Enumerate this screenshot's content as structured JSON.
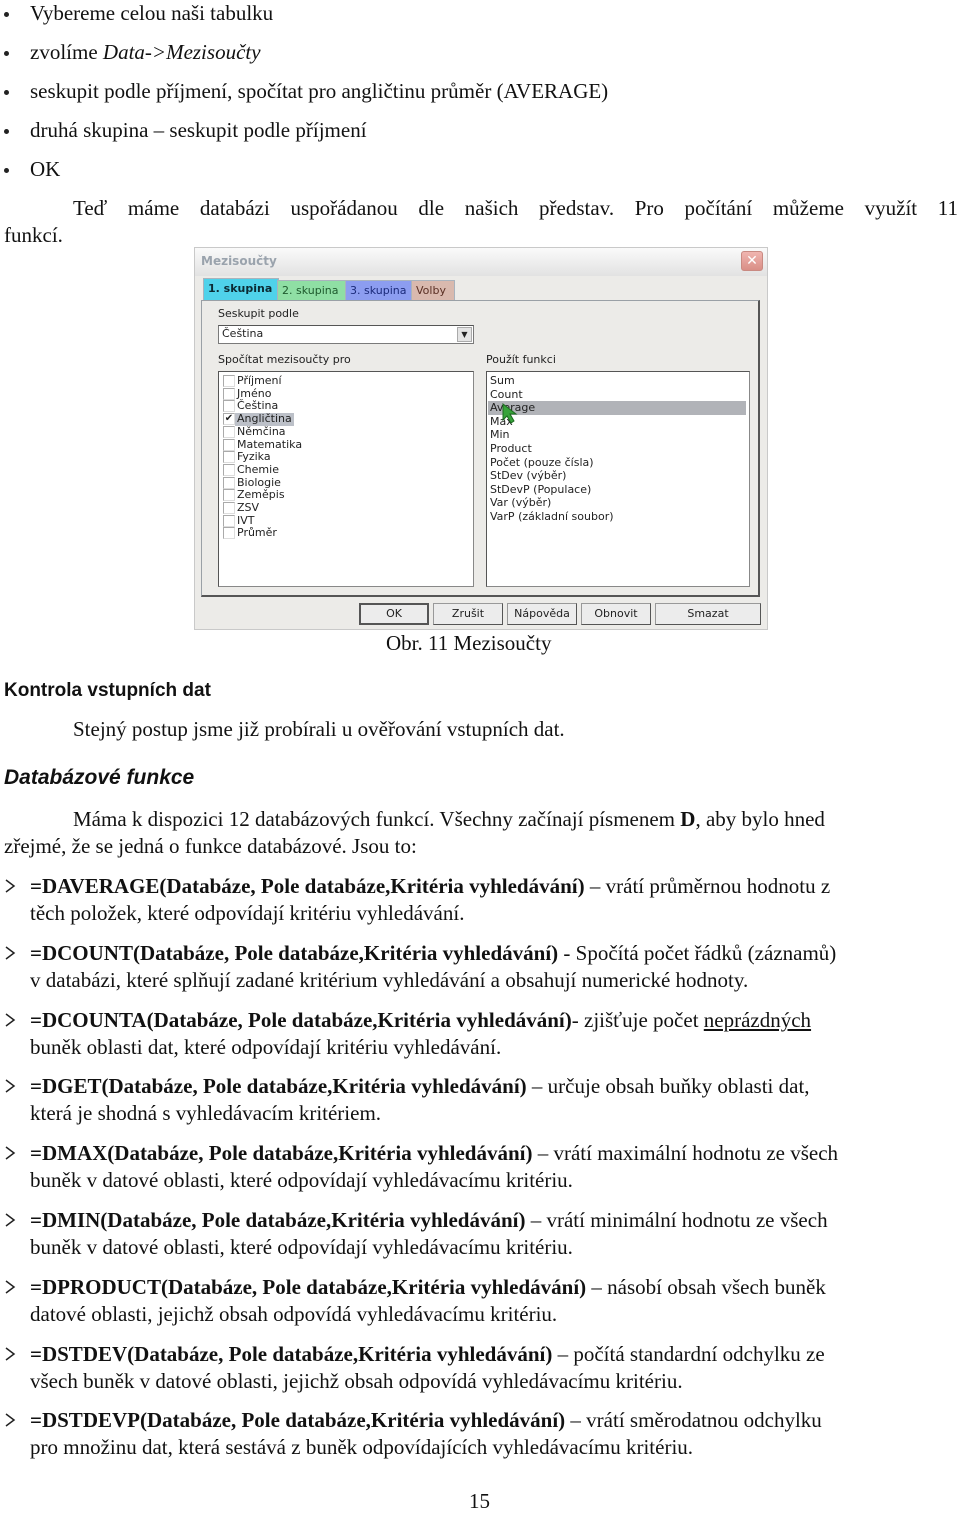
{
  "steps": [
    {
      "text": "Vybereme celou naši tabulku"
    },
    {
      "text_plain": "zvolíme ",
      "text_italic": "Data->Mezisoučty"
    },
    {
      "text": "seskupit podle příjmení, spočítat pro angličtinu průměr (AVERAGE)"
    },
    {
      "text": "druhá skupina – seskupit podle příjmení"
    },
    {
      "text": "OK"
    }
  ],
  "intro_paragraph": {
    "line1": "Teď máme databázi uspořádanou dle našich představ. Pro počítání můžeme využít 11",
    "line2": "funkcí."
  },
  "dialog": {
    "title": "Mezisoučty",
    "close_icon": "close-x-icon",
    "tabs": [
      {
        "label": "1. skupina",
        "active": true,
        "color": "#4fd2ea"
      },
      {
        "label": "2. skupina",
        "active": false,
        "color": "#8fdfa4"
      },
      {
        "label": "3. skupina",
        "active": false,
        "color": "#8c9df0"
      },
      {
        "label": "Volby",
        "active": false,
        "color": "#d9b9ae"
      }
    ],
    "group_by_label": "Seskupit podle",
    "group_by_value": "Čeština",
    "subtotals_for_label": "Spočítat mezisoučty pro",
    "columns": [
      {
        "name": "Příjmení",
        "checked": false
      },
      {
        "name": "Jméno",
        "checked": false
      },
      {
        "name": "Čeština",
        "checked": false
      },
      {
        "name": "Angličtina",
        "checked": true
      },
      {
        "name": "Němčina",
        "checked": false
      },
      {
        "name": "Matematika",
        "checked": false
      },
      {
        "name": "Fyzika",
        "checked": false
      },
      {
        "name": "Chemie",
        "checked": false
      },
      {
        "name": "Biologie",
        "checked": false
      },
      {
        "name": "Zeměpis",
        "checked": false
      },
      {
        "name": "ZSV",
        "checked": false
      },
      {
        "name": "IVT",
        "checked": false
      },
      {
        "name": "Průměr",
        "checked": false
      }
    ],
    "use_function_label": "Použít funkci",
    "functions": [
      {
        "name": "Sum",
        "selected": false
      },
      {
        "name": "Count",
        "selected": false
      },
      {
        "name": "Average",
        "selected": true
      },
      {
        "name": "Max",
        "selected": false
      },
      {
        "name": "Min",
        "selected": false
      },
      {
        "name": "Product",
        "selected": false
      },
      {
        "name": "Počet (pouze čísla)",
        "selected": false
      },
      {
        "name": "StDev (výběr)",
        "selected": false
      },
      {
        "name": "StDevP (Populace)",
        "selected": false
      },
      {
        "name": "Var (výběr)",
        "selected": false
      },
      {
        "name": "VarP (základní soubor)",
        "selected": false
      }
    ],
    "buttons": {
      "ok": "OK",
      "cancel": "Zrušit",
      "help": "Nápověda",
      "reset": "Obnovit",
      "delete": "Smazat"
    }
  },
  "figure_caption": "Obr. 11 Mezisoučty",
  "section_input_check": {
    "heading": "Kontrola vstupních dat",
    "text": "Stejný postup jsme již probírali u ověřování vstupních dat."
  },
  "section_db_functions": {
    "heading": "Databázové funkce",
    "intro_before_bold": "Máma k dispozici 12 databázových funkcí. Všechny začínají písmenem ",
    "intro_bold": "D",
    "intro_after_bold": ", aby bylo hned",
    "intro_line2": "zřejmé, že se jedná o funkce databázové. Jsou to:",
    "functions": [
      {
        "signature": "=DAVERAGE(Databáze, Pole databáze,Kritéria vyhledávání)",
        "desc1": " – vrátí průměrnou hodnotu z",
        "desc2": "těch položek, které odpovídají kritériu vyhledávání."
      },
      {
        "signature": "=DCOUNT(Databáze, Pole databáze,Kritéria vyhledávání)",
        "desc1": " - Spočítá počet řádků (záznamů)",
        "desc2": "v databázi, které splňují zadané kritérium vyhledávání a obsahují numerické hodnoty."
      },
      {
        "signature": "=DCOUNTA(Databáze, Pole databáze,Kritéria vyhledávání)",
        "desc1": "- zjišťuje počet ",
        "desc1_underlined": "neprázdných",
        "desc2": "buněk oblasti dat, které odpovídají kritériu vyhledávání."
      },
      {
        "signature": "=DGET(Databáze, Pole databáze,Kritéria vyhledávání)",
        "desc1": " – určuje obsah buňky oblasti dat,",
        "desc2": "která je shodná s vyhledávacím kritériem."
      },
      {
        "signature": "=DMAX(Databáze, Pole databáze,Kritéria vyhledávání)",
        "desc1": " – vrátí maximální hodnotu ze všech",
        "desc2": "buněk v datové oblasti, které odpovídají vyhledávacímu kritériu."
      },
      {
        "signature": "=DMIN(Databáze, Pole databáze,Kritéria vyhledávání)",
        "desc1": " – vrátí minimální hodnotu ze všech",
        "desc2": "buněk v datové oblasti, které odpovídají vyhledávacímu kritériu."
      },
      {
        "signature": "=DPRODUCT(Databáze, Pole databáze,Kritéria vyhledávání)",
        "desc1": " – násobí obsah všech buněk",
        "desc2": "datové oblasti, jejichž obsah odpovídá vyhledávacímu kritériu."
      },
      {
        "signature": "=DSTDEV(Databáze, Pole databáze,Kritéria vyhledávání)",
        "desc1": " – počítá standardní odchylku ze",
        "desc2": "všech buněk v datové oblasti, jejichž obsah odpovídá vyhledávacímu kritériu."
      },
      {
        "signature": "=DSTDEVP(Databáze, Pole databáze,Kritéria vyhledávání)",
        "desc1": " – vrátí směrodatnou odchylku",
        "desc2": "pro množinu dat, která sestává z buněk odpovídajících vyhledávacímu kritériu."
      }
    ]
  },
  "page_number": "15"
}
